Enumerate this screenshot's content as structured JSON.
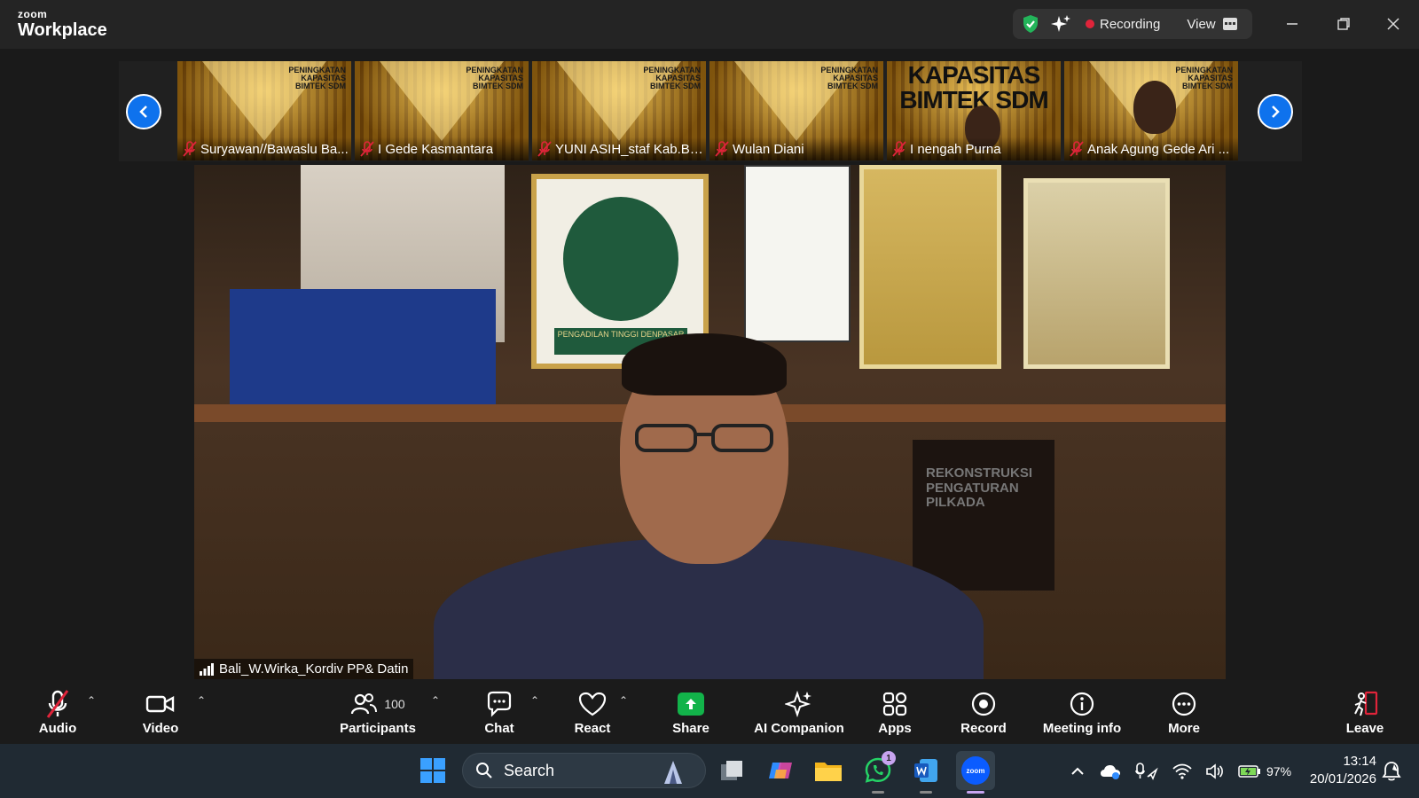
{
  "app": {
    "brand_small": "zoom",
    "brand_large": "Workplace"
  },
  "titlebar": {
    "recording_label": "Recording",
    "view_label": "View"
  },
  "thumbnails": [
    {
      "name": "Suryawan//Bawaslu Ba...",
      "slide_title": "PENINGKATAN KAPASITAS BIMTEK SDM"
    },
    {
      "name": "I Gede Kasmantara",
      "slide_title": "PENINGKATAN KAPASITAS BIMTEK SDM"
    },
    {
      "name": "YUNI ASIH_staf Kab.Ba...",
      "slide_title": "PENINGKATAN KAPASITAS BIMTEK SDM"
    },
    {
      "name": "Wulan Diani",
      "slide_title": "PENINGKATAN KAPASITAS BIMTEK SDM"
    },
    {
      "name": "I nengah Purna",
      "slide_title": "KAPASITAS BIMTEK SDM"
    },
    {
      "name": "Anak Agung Gede Ari ...",
      "slide_title": "PENINGKATAN KAPASITAS BIMTEK SDM"
    }
  ],
  "main_video": {
    "speaker_name": "Bali_W.Wirka_Kordiv PP& Datin",
    "plaque_label": "PENGADILAN TINGGI DENPASAR",
    "book_title": "REKONSTRUKSI PENGATURAN PILKADA"
  },
  "toolbar": {
    "audio": "Audio",
    "video": "Video",
    "participants": "Participants",
    "participant_count": "100",
    "chat": "Chat",
    "react": "React",
    "share": "Share",
    "ai_companion": "AI Companion",
    "apps": "Apps",
    "record": "Record",
    "meeting_info": "Meeting info",
    "more": "More",
    "leave": "Leave"
  },
  "taskbar": {
    "search_placeholder": "Search",
    "whatsapp_badge": "1",
    "battery": "97%",
    "time": "13:14",
    "date": "20/01/2026"
  },
  "colors": {
    "accent": "#0e72ed",
    "share_green": "#12b34a",
    "leave_red": "#e0243a",
    "recording_red": "#e0243a"
  }
}
